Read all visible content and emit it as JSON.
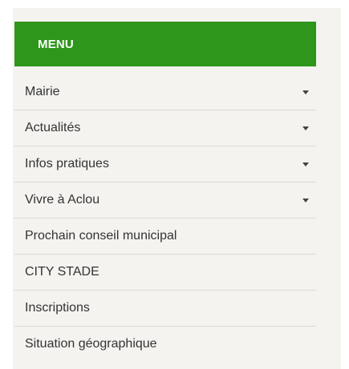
{
  "menu": {
    "title": "MENU",
    "items": [
      {
        "label": "Mairie",
        "has_submenu": true,
        "icon": "caret-down-icon"
      },
      {
        "label": "Actualités",
        "has_submenu": true,
        "icon": "caret-down-icon"
      },
      {
        "label": "Infos pratiques",
        "has_submenu": true,
        "icon": "caret-down-icon"
      },
      {
        "label": "Vivre à Aclou",
        "has_submenu": true,
        "icon": "caret-down-icon"
      },
      {
        "label": "Prochain conseil municipal",
        "has_submenu": false
      },
      {
        "label": "CITY STADE",
        "has_submenu": false
      },
      {
        "label": "Inscriptions",
        "has_submenu": false
      },
      {
        "label": "Situation géographique",
        "has_submenu": false
      }
    ]
  },
  "colors": {
    "header_background": "#2e961a",
    "panel_background": "#f4f3f0",
    "divider": "#dcdad5",
    "text": "#333333"
  }
}
